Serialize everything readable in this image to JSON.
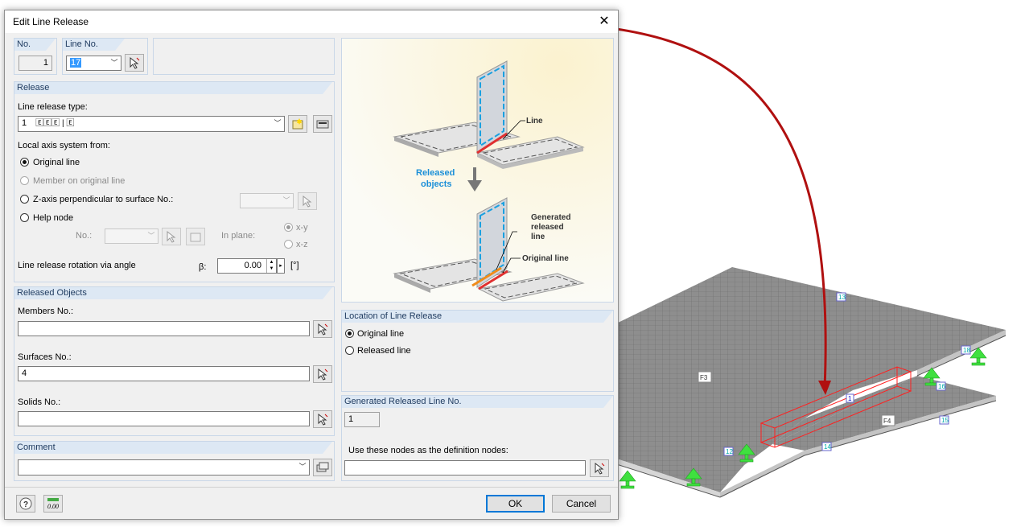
{
  "dialog": {
    "title": "Edit Line Release",
    "close_glyph": "✕"
  },
  "top": {
    "no_label": "No.",
    "no_value": "1",
    "line_no_label": "Line No.",
    "line_no_value": "17"
  },
  "release": {
    "header": "Release",
    "type_label": "Line release type:",
    "type_value_no": "1",
    "type_glyphs": "🄴🄴🄴 | 🄴",
    "axis_label": "Local axis system from:",
    "opt_original": "Original line",
    "opt_member": "Member on original line",
    "opt_zaxis": "Z-axis perpendicular to surface No.:",
    "opt_help": "Help node",
    "no_label": "No.:",
    "in_plane_label": "In plane:",
    "plane_xy": "x-y",
    "plane_xz": "x-z",
    "rotation_label": "Line release rotation via angle",
    "beta_label": "β:",
    "beta_value": "0.00",
    "beta_unit": "[°]"
  },
  "released_objects": {
    "header": "Released Objects",
    "members_label": "Members No.:",
    "members_value": "",
    "surfaces_label": "Surfaces No.:",
    "surfaces_value": "4",
    "solids_label": "Solids No.:",
    "solids_value": ""
  },
  "comment": {
    "header": "Comment",
    "value": ""
  },
  "diagram": {
    "line_label": "Line",
    "released_label_1": "Released",
    "released_label_2": "objects",
    "generated_1": "Generated",
    "generated_2": "released",
    "generated_3": "line",
    "original_line": "Original line"
  },
  "location": {
    "header": "Location of Line Release",
    "opt_original": "Original line",
    "opt_released": "Released line"
  },
  "generated": {
    "header": "Generated Released Line No.",
    "value": "1",
    "nodes_label": "Use these nodes as the definition nodes:",
    "nodes_value": ""
  },
  "footer": {
    "ok": "OK",
    "cancel": "Cancel"
  },
  "model": {
    "labels": {
      "n13": "13",
      "n18": "18",
      "f3": "F3",
      "n16": "16",
      "line1": "1",
      "f4": "F4",
      "n15": "15",
      "n12": "12",
      "n14": "14"
    },
    "colors": {
      "arrow": "#b01010",
      "slab": "#8a8a8a",
      "support": "#3fe03f",
      "release": "#ff2020"
    }
  }
}
